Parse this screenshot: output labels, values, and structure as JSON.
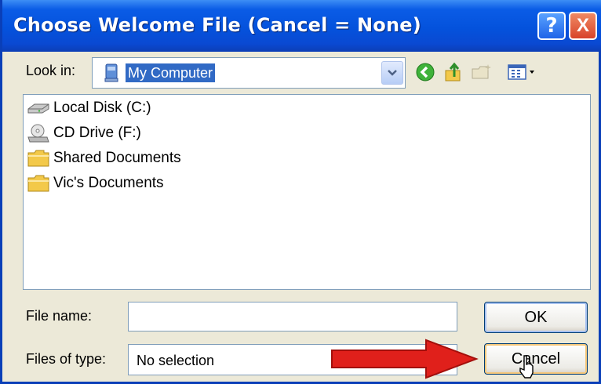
{
  "window": {
    "title": "Choose Welcome File (Cancel = None)",
    "help_label": "?",
    "close_label": "X"
  },
  "toolbar": {
    "lookin_label": "Look in:",
    "lookin_value": "My Computer",
    "icons": [
      "back-icon",
      "up-folder-icon",
      "new-folder-icon",
      "views-menu-icon"
    ]
  },
  "file_list": [
    {
      "label": "Local Disk (C:)",
      "icon": "hard-drive-icon"
    },
    {
      "label": "CD Drive (F:)",
      "icon": "cd-drive-icon"
    },
    {
      "label": "Shared Documents",
      "icon": "folder-icon"
    },
    {
      "label": "Vic's Documents",
      "icon": "folder-icon"
    }
  ],
  "form": {
    "filename_label": "File name:",
    "filename_value": "",
    "filetype_label": "Files of type:",
    "filetype_value": "No selection"
  },
  "buttons": {
    "ok": "OK",
    "cancel": "Cancel"
  },
  "colors": {
    "titlebar": "#0452dc",
    "selection": "#316ac5",
    "annotation_arrow": "#e0201b"
  }
}
